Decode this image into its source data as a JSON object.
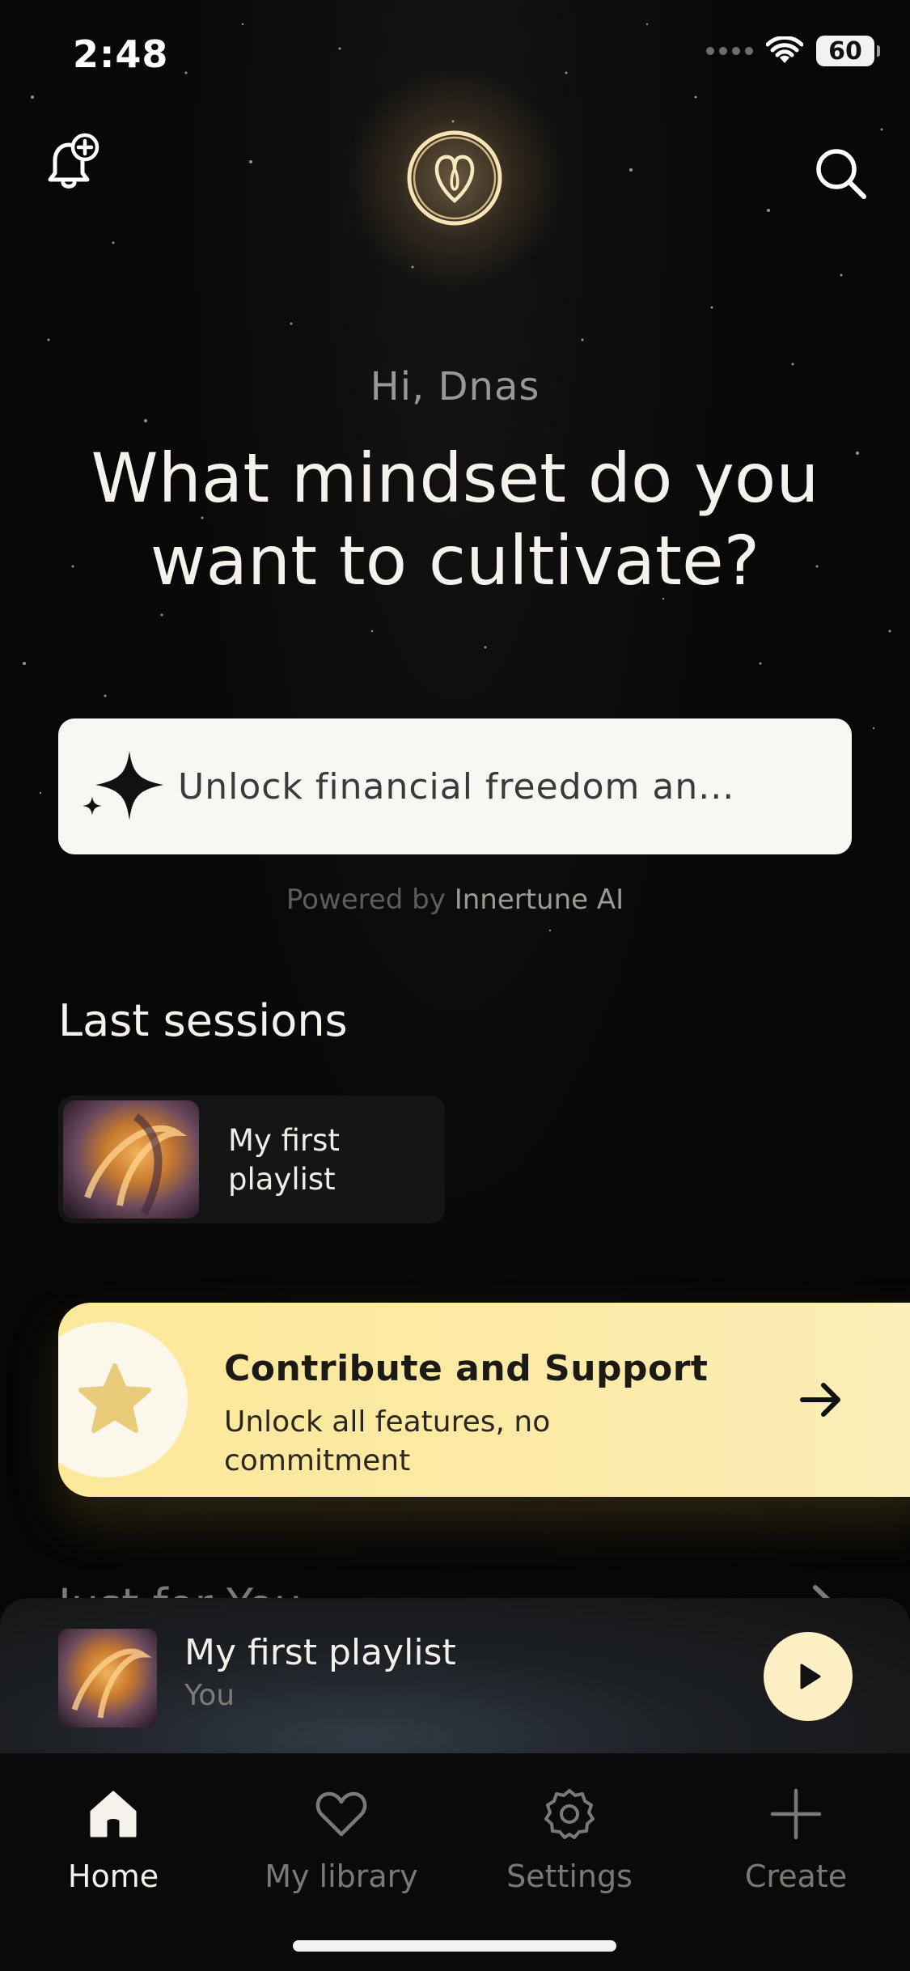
{
  "status_bar": {
    "time": "2:48",
    "battery": "60"
  },
  "header": {
    "greeting": "Hi, Dnas",
    "headline": "What mindset do you want to cultivate?"
  },
  "prompt": {
    "placeholder": "Unlock financial freedom an...",
    "powered_prefix": "Powered by",
    "powered_brand": "Innertune AI"
  },
  "last_sessions": {
    "title": "Last sessions",
    "items": [
      {
        "label": "My first playlist"
      }
    ]
  },
  "support": {
    "title": "Contribute and Support",
    "subtitle": "Unlock all features, no commitment"
  },
  "next_section": {
    "title": "Just for You"
  },
  "now_playing": {
    "title": "My first playlist",
    "artist": "You"
  },
  "tabs": [
    {
      "label": "Home",
      "icon": "home-icon",
      "active": true
    },
    {
      "label": "My library",
      "icon": "heart-icon",
      "active": false
    },
    {
      "label": "Settings",
      "icon": "gear-icon",
      "active": false
    },
    {
      "label": "Create",
      "icon": "plus-icon",
      "active": false
    }
  ],
  "colors": {
    "accent": "#fdf0c4",
    "support_bg": "#fde99a",
    "background": "#050505"
  }
}
